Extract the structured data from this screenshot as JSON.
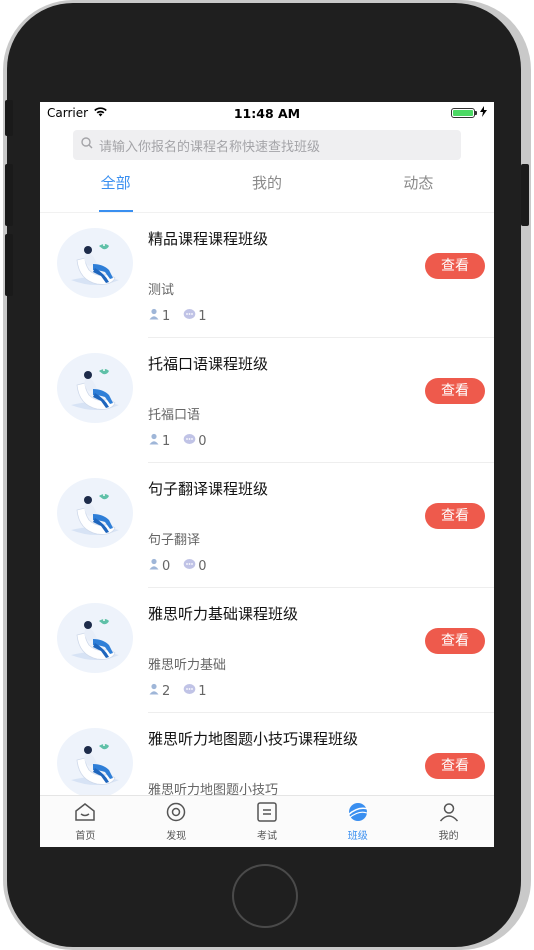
{
  "status_bar": {
    "carrier": "Carrier",
    "time": "11:48 AM",
    "battery_level": 1.0
  },
  "search": {
    "placeholder": "请输入你报名的课程名称快速查找班级"
  },
  "tabs": [
    {
      "label": "全部",
      "active": true
    },
    {
      "label": "我的",
      "active": false
    },
    {
      "label": "动态",
      "active": false
    }
  ],
  "courses": [
    {
      "title": "精品课程课程班级",
      "subtitle": "测试",
      "members": "1",
      "comments": "1",
      "action": "查看"
    },
    {
      "title": "托福口语课程班级",
      "subtitle": "托福口语",
      "members": "1",
      "comments": "0",
      "action": "查看"
    },
    {
      "title": "句子翻译课程班级",
      "subtitle": "句子翻译",
      "members": "0",
      "comments": "0",
      "action": "查看"
    },
    {
      "title": "雅思听力基础课程班级",
      "subtitle": "雅思听力基础",
      "members": "2",
      "comments": "1",
      "action": "查看"
    },
    {
      "title": "雅思听力地图题小技巧课程班级",
      "subtitle": "雅思听力地图题小技巧",
      "members": "",
      "comments": "",
      "action": "查看"
    }
  ],
  "tabbar": [
    {
      "label": "首页",
      "icon": "home-icon",
      "active": false
    },
    {
      "label": "发现",
      "icon": "discover-icon",
      "active": false
    },
    {
      "label": "考试",
      "icon": "exam-icon",
      "active": false
    },
    {
      "label": "班级",
      "icon": "class-icon",
      "active": true
    },
    {
      "label": "我的",
      "icon": "profile-icon",
      "active": false
    }
  ],
  "colors": {
    "accent": "#3a8ff0",
    "action_button": "#ee5a4c",
    "battery": "#4cd964"
  }
}
